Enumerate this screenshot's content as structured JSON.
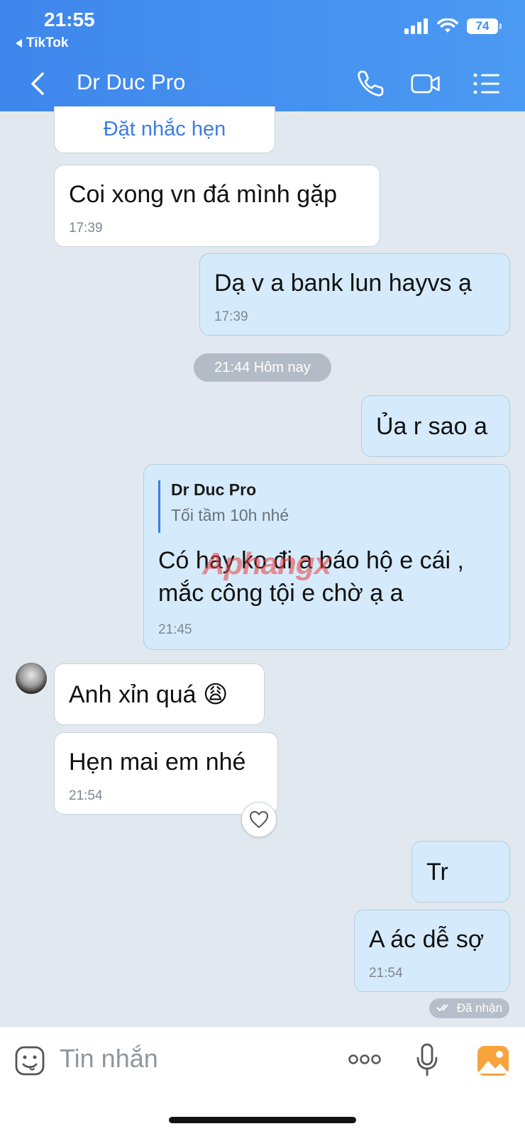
{
  "status_bar": {
    "time": "21:55",
    "back_app": "TikTok",
    "battery": "74"
  },
  "header": {
    "title": "Dr Duc Pro"
  },
  "messages": {
    "reminder": {
      "label": "Đặt nhắc hẹn"
    },
    "m1": {
      "text": "Coi xong vn đá mình gặp",
      "time": "17:39"
    },
    "m2": {
      "text": "Dạ v a bank lun hayvs ạ",
      "time": "17:39"
    },
    "date_divider": "21:44 Hôm nay",
    "m3": {
      "text": "Ủa r sao a"
    },
    "m4": {
      "quote_name": "Dr Duc Pro",
      "quote_text": "Tối tầm 10h nhé",
      "line1": "Có hay ko đi a báo hộ e cái ,",
      "line2": "mắc công tội e chờ ạ a",
      "time": "21:45"
    },
    "m5": {
      "text": "Anh xỉn quá 😩"
    },
    "m6": {
      "text": "Hẹn mai em nhé",
      "time": "21:54"
    },
    "m7": {
      "text": "Tr"
    },
    "m8": {
      "text": "A ác dễ sợ",
      "time": "21:54"
    },
    "delivery_status": "Đã nhận"
  },
  "watermark": "Aphangx",
  "input": {
    "placeholder": "Tin nhắn"
  },
  "colors": {
    "header": "#4290ee",
    "background": "#e2e8ef",
    "my_bubble": "#d5ebfb",
    "accent": "#3c7de6",
    "image_button": "#f7a33c"
  }
}
